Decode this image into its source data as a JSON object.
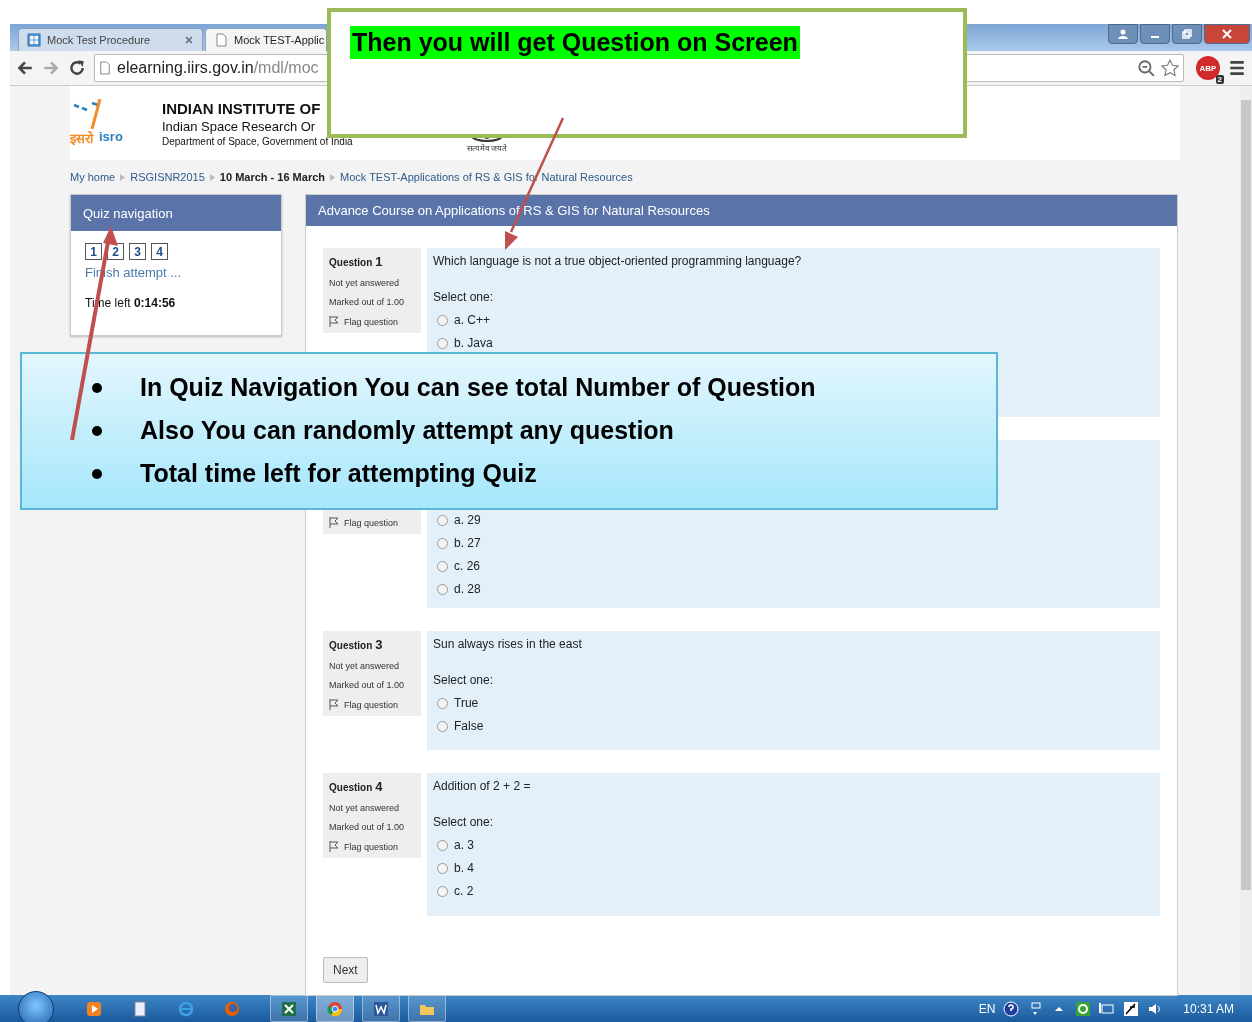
{
  "browser": {
    "tabs": [
      {
        "label": "Mock Test Procedure",
        "selected": false
      },
      {
        "label": "Mock TEST-Applic",
        "selected": true
      }
    ],
    "address": {
      "host": "elearning.iirs.gov.in",
      "path": "/mdl/moc"
    },
    "extension_badge": "ABP",
    "extension_count": "2"
  },
  "site_header": {
    "logo_hindi": "इसरो",
    "logo_latin": "isro",
    "title": "INDIAN INSTITUTE OF",
    "subtitle": "Indian Space Research Or",
    "department": "Department of Space, Government of India",
    "motto": "सत्यमेव जयते"
  },
  "breadcrumb": [
    {
      "label": "My home",
      "emphasized": false
    },
    {
      "label": "RSGISNR2015",
      "emphasized": false
    },
    {
      "label": "10 March - 16 March",
      "emphasized": true
    },
    {
      "label": "Mock TEST-Applications of RS & GIS for Natural Resources",
      "emphasized": false
    }
  ],
  "quiz_navigation": {
    "title": "Quiz navigation",
    "buttons": [
      "1",
      "2",
      "3",
      "4"
    ],
    "finish_link": "Finish attempt ...",
    "time_label": "Time left",
    "time_value": "0:14:56"
  },
  "course_title": "Advance Course on Applications of RS & GIS for Natural Resources",
  "questions": [
    {
      "label": "Question",
      "number": "1",
      "status": "Not yet answered",
      "marks": "Marked out of 1.00",
      "flag": "Flag question",
      "text": "Which language is not a true object-oriented programming language?",
      "prompt": "Select one:",
      "options": [
        {
          "letter": "a.",
          "text": "C++",
          "selected": false
        },
        {
          "letter": "b.",
          "text": "Java",
          "selected": false
        }
      ]
    },
    {
      "flag": "Flag question",
      "options": [
        {
          "letter": "a.",
          "text": "29",
          "selected": false
        },
        {
          "letter": "b.",
          "text": "27",
          "selected": false
        },
        {
          "letter": "c.",
          "text": "26",
          "selected": false
        },
        {
          "letter": "d.",
          "text": "28",
          "selected": false
        }
      ]
    },
    {
      "label": "Question",
      "number": "3",
      "status": "Not yet answered",
      "marks": "Marked out of 1.00",
      "flag": "Flag question",
      "text": "Sun always rises in the east",
      "prompt": "Select one:",
      "options": [
        {
          "text": "True",
          "selected": false
        },
        {
          "text": "False",
          "selected": false
        }
      ]
    },
    {
      "label": "Question",
      "number": "4",
      "status": "Not yet answered",
      "marks": "Marked out of 1.00",
      "flag": "Flag question",
      "text": "Addition of 2 + 2 =",
      "prompt": "Select one:",
      "options": [
        {
          "letter": "a.",
          "text": "3",
          "selected": false
        },
        {
          "letter": "b.",
          "text": "4",
          "selected": false
        },
        {
          "letter": "c.",
          "text": "2",
          "selected": false
        }
      ]
    }
  ],
  "next_button": "Next",
  "taskbar": {
    "language": "EN",
    "clock": "10:31 AM"
  },
  "callouts": [
    {
      "kind": "highlight",
      "text": "Then you will get Question on Screen"
    },
    {
      "kind": "bullets",
      "items": [
        "In Quiz Navigation You can see total  Number of Question",
        "Also You can randomly attempt any question",
        "Total time left for attempting Quiz"
      ]
    }
  ]
}
